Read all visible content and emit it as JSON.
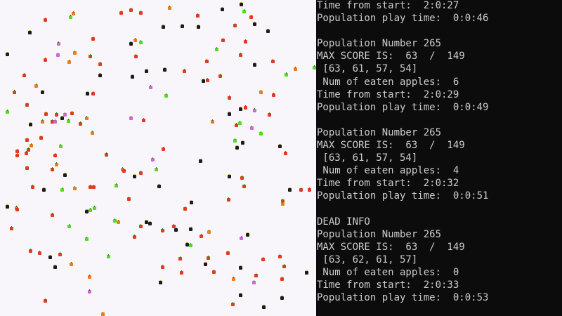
{
  "console": {
    "lines": [
      "Time from start:  2:0:27",
      "Population play time:  0:0:46",
      "",
      "Population Number 265",
      "MAX SCORE IS:  63  /  149",
      " [63, 61, 57, 54]",
      " Num of eaten apples:  6",
      "Time from start:  2:0:29",
      "Population play time:  0:0:49",
      "",
      "Population Number 265",
      "MAX SCORE IS:  63  /  149",
      " [63, 61, 57, 54]",
      " Num of eaten apples:  4",
      "Time from start:  2:0:32",
      "Population play time:  0:0:51",
      "",
      "DEAD INFO",
      "Population Number 265",
      "MAX SCORE IS:  63  /  149",
      " [63, 62, 61, 57]",
      " Num of eaten apples:  0",
      "Time from start:  2:0:33",
      "Population play time:  0:0:53"
    ]
  },
  "game": {
    "sprite_kinds": {
      "apple": "red-apple-icon",
      "bug": "bug-icon",
      "green": "green-apple-icon",
      "pink": "pink-berry-icon",
      "orange": "orange-fruit-icon"
    },
    "colors": {
      "board": "#f8f6fa",
      "console_bg": "#0c0c0c",
      "console_text": "#cccccc",
      "apple": "#e23a1c",
      "green": "#4ce01a"
    }
  }
}
